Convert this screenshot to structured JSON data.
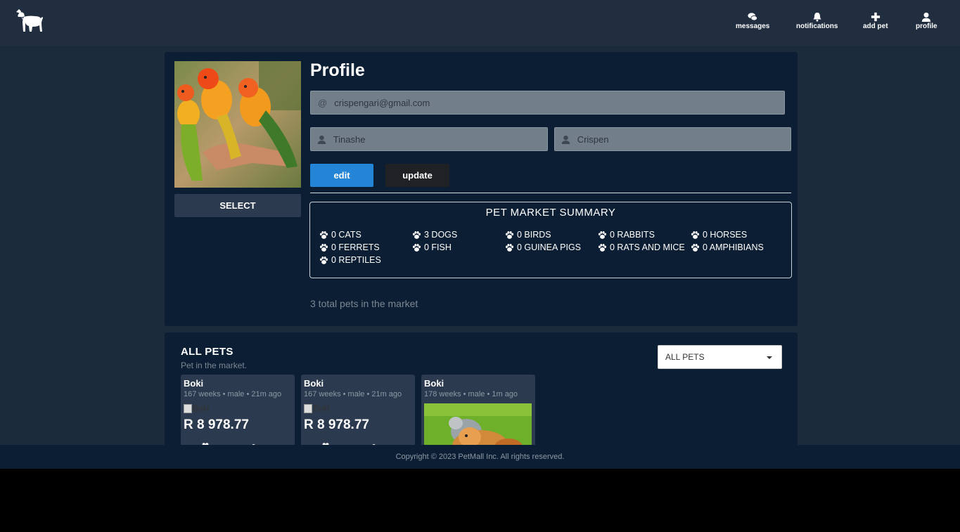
{
  "nav": {
    "items": [
      {
        "label": "messages",
        "icon": "comments-icon"
      },
      {
        "label": "notifications",
        "icon": "bell-icon"
      },
      {
        "label": "add pet",
        "icon": "plus-icon"
      },
      {
        "label": "profile",
        "icon": "user-icon"
      }
    ]
  },
  "profile": {
    "title": "Profile",
    "select_label": "SELECT",
    "email": "crispengari@gmail.com",
    "first_name": "Tinashe",
    "last_name": "Crispen",
    "edit_label": "edit",
    "update_label": "update"
  },
  "summary": {
    "title": "PET MARKET SUMMARY",
    "items": [
      "0 CATS",
      "3 DOGS",
      "0 BIRDS",
      "0 RABBITS",
      "0 HORSES",
      "0 FERRETS",
      "0 FISH",
      "0 GUINEA PIGS",
      "0 RATS AND MICE",
      "0 AMPHIBIANS",
      "0 REPTILES"
    ],
    "total_text": "3 total pets in the market"
  },
  "pets": {
    "title": "ALL PETS",
    "subtitle": "Pet in the market.",
    "filter_value": "ALL PETS",
    "cards": [
      {
        "name": "Boki",
        "meta": "167 weeks • male • 21m ago",
        "alt": "Boki",
        "price": "R 8 978.77"
      },
      {
        "name": "Boki",
        "meta": "167 weeks • male • 21m ago",
        "alt": "Boki",
        "price": "R 8 978.77"
      },
      {
        "name": "Boki",
        "meta": "178 weeks • male • 1m ago"
      }
    ]
  },
  "footer": {
    "copyright": "Copyright © 2023 PetMall Inc. All rights reserved."
  },
  "colors": {
    "page_bg": "#1c2b3c",
    "panel_bg": "#0c1e33",
    "edit_button": "#2484d6",
    "update_button": "#1f2125"
  }
}
